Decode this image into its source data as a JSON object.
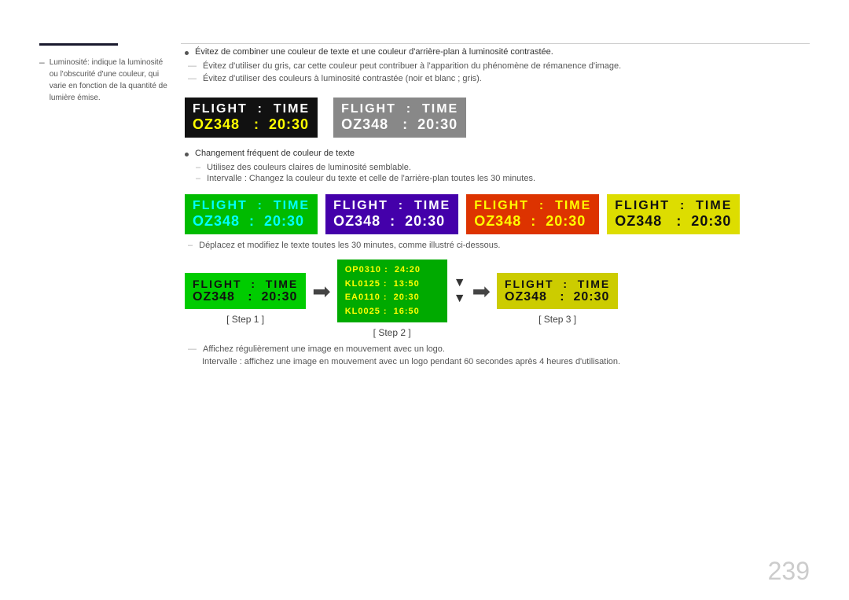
{
  "page": {
    "number": "239"
  },
  "sidebar": {
    "text": "Luminosité: indique la luminosité ou l'obscurité d'une couleur, qui varie en fonction de la quantité de lumière émise."
  },
  "main": {
    "bullet1": "Évitez de combiner une couleur de texte et une couleur d'arrière-plan à luminosité contrastée.",
    "dash1": "Évitez d'utiliser du gris, car cette couleur peut contribuer à l'apparition du phénomène de rémanence d'image.",
    "dash2": "Évitez d'utiliser des couleurs à luminosité contrastée (noir et blanc ; gris).",
    "bullet2": "Changement fréquent de couleur de texte",
    "sub1": "Utilisez des couleurs claires de luminosité semblable.",
    "sub2": "Intervalle : Changez la couleur du texte et celle de l'arrière-plan toutes les 30 minutes.",
    "steps_note": "Déplacez et modifiez le texte toutes les 30 minutes, comme illustré ci-dessous.",
    "note1": "Affichez régulièrement une image en mouvement avec un logo.",
    "note2": "Intervalle : affichez une image en mouvement avec un logo pendant 60 secondes après 4 heures d'utilisation.",
    "flight": {
      "label1": "FLIGHT",
      "colon": ":",
      "label2": "TIME",
      "oz": "OZ348",
      "time": "20:30"
    },
    "boxes": {
      "box1": {
        "bg": "black",
        "row1_color": "white",
        "row2_color": "yellow"
      },
      "box2": {
        "bg": "gray",
        "row1_color": "white",
        "row2_color": "white"
      }
    },
    "color_variants": [
      {
        "bg": "cyan-on-green",
        "r1c": "cyan",
        "r2c": "cyan"
      },
      {
        "bg": "white-on-purple",
        "r1c": "white",
        "r2c": "white"
      },
      {
        "bg": "yellow-on-orange",
        "r1c": "yellow",
        "r2c": "yellow"
      },
      {
        "bg": "black-on-yellow",
        "r1c": "black",
        "r2c": "black"
      }
    ],
    "steps": {
      "step1_label": "[ Step 1 ]",
      "step2_label": "[ Step 2 ]",
      "step3_label": "[ Step 3 ]",
      "multi_lines": [
        "OP0310 :  24:20",
        "KL0125 :  13:50",
        "EA0110 :  20:30",
        "KL0025 :  16:50"
      ]
    }
  }
}
